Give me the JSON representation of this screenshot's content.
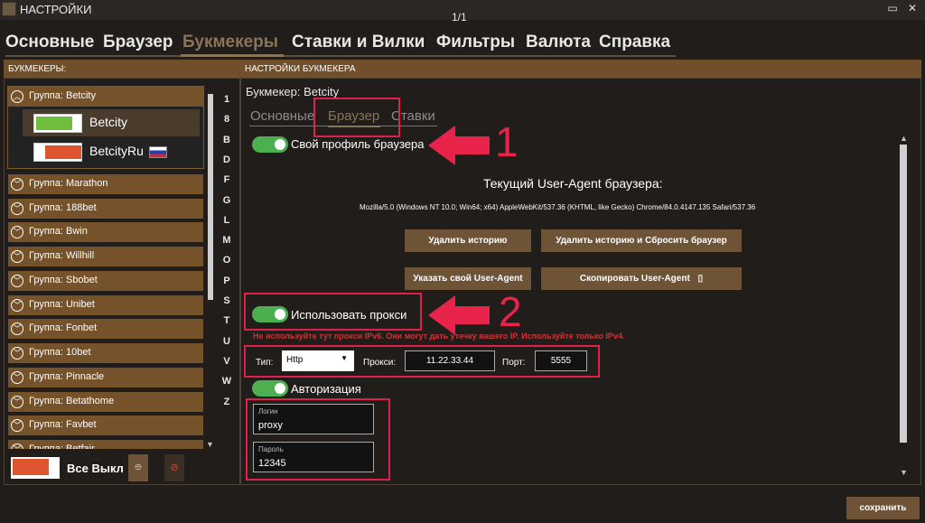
{
  "window": {
    "title": "НАСТРОЙКИ",
    "pager": "1/1",
    "maximize_icon": "maximize-icon",
    "close_icon": "close-icon"
  },
  "main_tabs": [
    "Основные",
    "Браузер",
    "Букмекеры",
    "Ставки и Вилки",
    "Фильтры",
    "Валюта",
    "Справка"
  ],
  "main_tab_active": "Букмекеры",
  "left_panel": {
    "header": "БУКМЕКЕРЫ:",
    "open_group": {
      "label": "Группа: Betcity",
      "items": [
        {
          "name": "Betcity",
          "enabled": true,
          "color": "#6fbf3d"
        },
        {
          "name": "BetcityRu",
          "enabled": false,
          "color": "#df5530",
          "flag": "russia-flag-icon"
        }
      ]
    },
    "groups": [
      "Группа: Marathon",
      "Группа: 188bet",
      "Группа: Bwin",
      "Группа: Willhill",
      "Группа: Sbobet",
      "Группа: Unibet",
      "Группа: Fonbet",
      "Группа: 10bet",
      "Группа: Pinnacle",
      "Группа: Betathome",
      "Группа: Favbet",
      "Группа: Betfair"
    ],
    "letters": [
      "1",
      "8",
      "B",
      "D",
      "F",
      "G",
      "L",
      "M",
      "O",
      "P",
      "S",
      "T",
      "U",
      "V",
      "W",
      "Z"
    ],
    "all_off_label": "Все Выкл",
    "all_off_color": "#df5530"
  },
  "right_panel": {
    "header": "НАСТРОЙКИ БУКМЕКЕРА",
    "bookmaker_title": "Букмекер: Betcity",
    "sub_tabs": [
      "Основные",
      "Браузер",
      "Ставки"
    ],
    "sub_tab_active": "Браузер",
    "own_profile_label": "Свой профиль браузера",
    "ua_title": "Текущий User-Agent браузера:",
    "ua_string": "Mozilla/5.0 (Windows NT 10.0; Win64; x64) AppleWebKit/537.36 (KHTML, like Gecko) Chrome/84.0.4147.135 Safari/537.36",
    "buttons": {
      "clear_history": "Удалить историю",
      "clear_reset": "Удалить историю и Сбросить браузер",
      "set_ua": "Указать свой User-Agent",
      "copy_ua": "Скопировать User-Agent"
    },
    "use_proxy_label": "Использовать прокси",
    "warning": "Не используйте тут прокси IPv6. Они могут дать утечку вашего IP. Используйте только IPv4.",
    "proxy": {
      "type_label": "Тип:",
      "type_value": "Http",
      "proxy_label": "Прокси:",
      "proxy_value": "11.22.33.44",
      "port_label": "Порт:",
      "port_value": "5555"
    },
    "auth_label": "Авторизация",
    "login_label": "Логин",
    "login_value": "proxy",
    "password_label": "Пароль",
    "password_value": "12345"
  },
  "annotations": {
    "n1": "1",
    "n2": "2",
    "color": "#e8234a"
  },
  "save_label": "сохранить"
}
